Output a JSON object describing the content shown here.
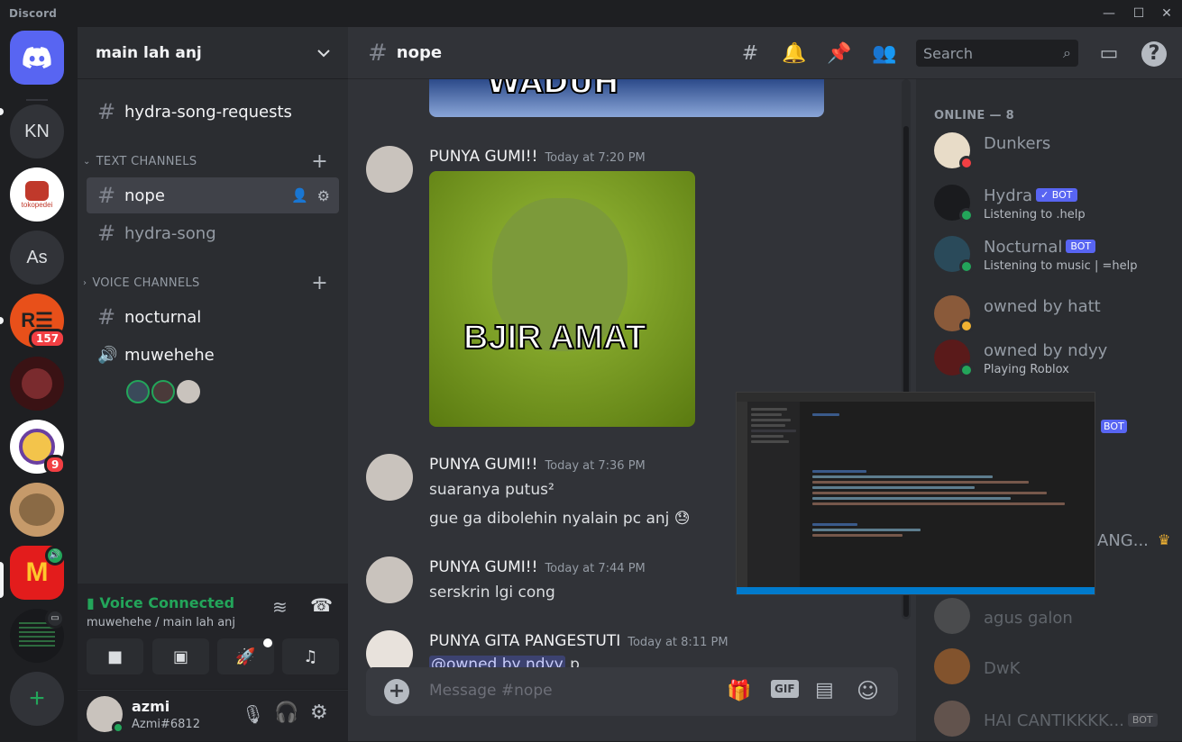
{
  "window": {
    "brand": "Discord",
    "minimize": "—",
    "maximize": "☐",
    "close": "✕"
  },
  "servers": [
    {
      "label": "KN"
    },
    {
      "label": "tokopedei"
    },
    {
      "label": "As"
    },
    {
      "label": "",
      "badge": "157"
    },
    {
      "label": ""
    },
    {
      "label": "",
      "badge": "9"
    },
    {
      "label": ""
    },
    {
      "label": ""
    },
    {
      "label": ""
    }
  ],
  "add_server": "+",
  "guild": {
    "name": "main lah anj",
    "chevron": "⌄"
  },
  "channels": {
    "top": [
      {
        "name": "hydra-song-requests"
      }
    ],
    "text_category": "TEXT CHANNELS",
    "text": [
      {
        "name": "nope"
      },
      {
        "name": "hydra-song"
      }
    ],
    "voice_category": "VOICE CHANNELS",
    "voice": [
      {
        "name": "nocturnal",
        "icon": "#"
      },
      {
        "name": "muwehehe",
        "icon": "🔊"
      }
    ]
  },
  "voice_panel": {
    "status": "Voice Connected",
    "location": "muwehehe / main lah anj"
  },
  "user": {
    "name": "azmi",
    "tag": "Azmi#6812"
  },
  "chat": {
    "channel": "nope",
    "search_placeholder": "Search",
    "input_placeholder": "Message #nope",
    "messages": [
      {
        "author": "PUNYA GUMI!!",
        "time": "Today at 7:20 PM",
        "image_text": "BJIR AMAT"
      },
      {
        "author": "PUNYA GUMI!!",
        "time": "Today at 7:36 PM",
        "lines": [
          "suaranya putus²",
          "gue ga dibolehin nyalain pc anj 😓"
        ]
      },
      {
        "author": "PUNYA GUMI!!",
        "time": "Today at 7:44 PM",
        "lines": [
          "serskrin lgi cong"
        ]
      },
      {
        "author": "PUNYA GITA PANGESTUTI",
        "time": "Today at 8:11 PM",
        "mention": "@owned by ndyy",
        "after": "p"
      }
    ],
    "top_image_text": "WADUH"
  },
  "members": {
    "online_header": "ONLINE — 8",
    "list": [
      {
        "name": "Dunkers",
        "sub": "",
        "bot": false,
        "status": "dnd"
      },
      {
        "name": "Hydra",
        "sub": "Listening to .help",
        "bot": true,
        "bot_label": "✓ BOT",
        "status": "online"
      },
      {
        "name": "Nocturnal",
        "sub": "Listening to music | =help",
        "bot": true,
        "bot_label": "BOT",
        "status": "online"
      },
      {
        "name": "owned by hatt",
        "sub": "",
        "bot": false,
        "status": "idle"
      },
      {
        "name": "owned by ndyy",
        "sub": "Playing Roblox",
        "bot": false,
        "status": "online"
      },
      {
        "name": "agus galon",
        "sub": "",
        "bot": false,
        "status": "offline"
      },
      {
        "name": "DwK",
        "sub": "",
        "bot": false,
        "status": "offline"
      },
      {
        "name": "HAI CANTIKKKK...",
        "sub": "",
        "bot": true,
        "bot_label": "BOT",
        "status": "offline"
      }
    ],
    "partial_name": "ANG...",
    "partial_bot": "BOT"
  },
  "colors": {
    "accent": "#5865f2",
    "online": "#23a55a",
    "dnd": "#f23f43",
    "idle": "#f0b232",
    "voice": "#23a55a"
  }
}
